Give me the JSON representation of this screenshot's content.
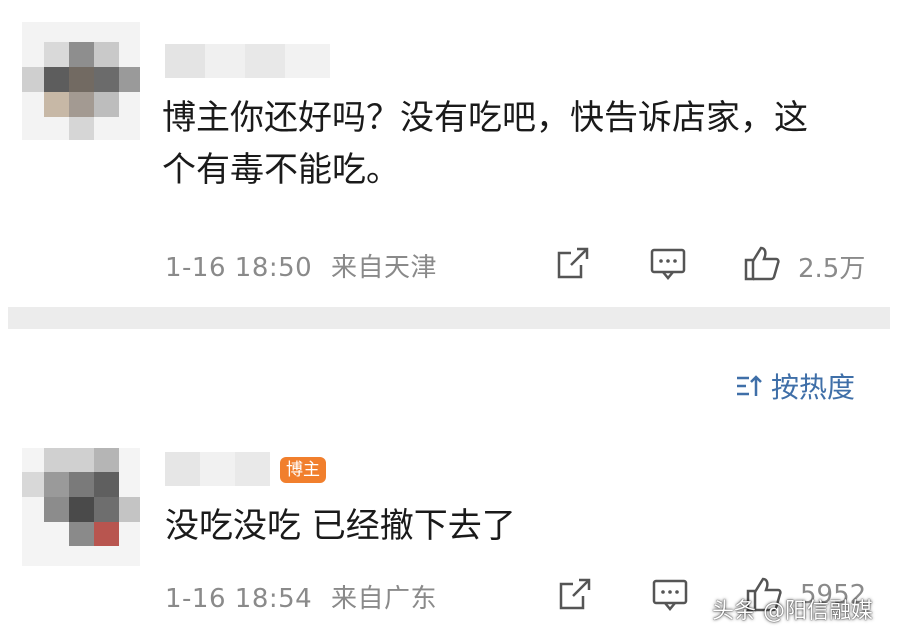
{
  "comments": [
    {
      "text_line1": "博主你还好吗？没有吃吧，快告诉店家，这",
      "text_line2": "个有毒不能吃。",
      "time": "1-16 18:50",
      "location": "来自天津",
      "likes": "2.5万"
    },
    {
      "badge": "博主",
      "text": "没吃没吃 已经撤下去了",
      "time": "1-16 18:54",
      "location": "来自广东",
      "likes": "5952"
    }
  ],
  "sort": {
    "label": "按热度",
    "icon": "sort-icon"
  },
  "watermark": "头条 @阳信融媒",
  "colors": {
    "badge": "#f17f2d",
    "sort": "#3f6fa8",
    "meta": "#8a8a8a",
    "divider": "#ececec"
  }
}
